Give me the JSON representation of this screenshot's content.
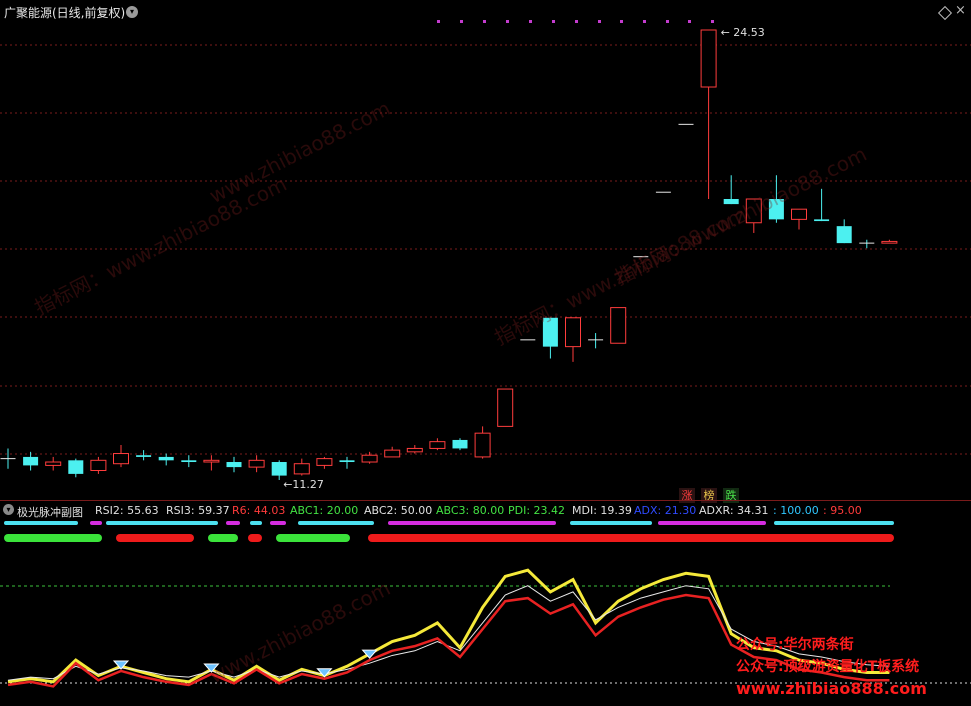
{
  "header": {
    "title": "广聚能源(日线,前复权)",
    "high_label": "24.53",
    "low_label": "11.27"
  },
  "tags": [
    "涨",
    "榜",
    "跌"
  ],
  "indicator": {
    "name": "极光脉冲副图",
    "fields": [
      {
        "text": "RSI2: 55.63",
        "color": "#e0e0e0"
      },
      {
        "text": "RSI3: 59.37",
        "color": "#e0e0e0"
      },
      {
        "text": "R6: 44.03",
        "color": "#ff3b3b"
      },
      {
        "text": "ABC1: 20.00",
        "color": "#43e243"
      },
      {
        "text": "ABC2: 50.00",
        "color": "#e0e0e0"
      },
      {
        "text": "ABC3: 80.00",
        "color": "#43e243"
      },
      {
        "text": "PDI: 23.42",
        "color": "#43e243"
      },
      {
        "text": "MDI: 19.39",
        "color": "#e0e0e0"
      },
      {
        "text": "ADX: 21.30",
        "color": "#2f4bff"
      },
      {
        "text": "ADXR: 34.31",
        "color": "#e0e0e0"
      },
      {
        "text": ": 100.00",
        "color": "#2fc7ff"
      },
      {
        "text": ": 95.00",
        "color": "#ff3b3b"
      }
    ]
  },
  "watermarks": [
    "指标网：www.zhibiao88.com",
    "指标网：www.zhibiao88.com",
    "www.zhibiao88.com",
    "指标网：www.zhibiao88.com",
    "www.zhibiao88.com"
  ],
  "promo": {
    "line1": "公众号:华尔两条街",
    "line2": "公众号:顶级游资量化T板系统",
    "line3": "www.zhibiao888.com"
  },
  "colors": {
    "up": "#ff3d3d",
    "down": "#4cf0f0",
    "grid": "#7a1b1b",
    "rsi": "#f5e93a"
  },
  "chart_data": {
    "type": "candlestick",
    "title": "广聚能源(日线,前复权)",
    "candles": [
      {
        "o": 11.9,
        "c": 11.9,
        "h": 12.2,
        "l": 11.6
      },
      {
        "o": 11.95,
        "c": 11.7,
        "h": 12.1,
        "l": 11.55
      },
      {
        "o": 11.7,
        "c": 11.8,
        "h": 11.95,
        "l": 11.55
      },
      {
        "o": 11.85,
        "c": 11.45,
        "h": 11.9,
        "l": 11.35
      },
      {
        "o": 11.55,
        "c": 11.85,
        "h": 11.95,
        "l": 11.45
      },
      {
        "o": 11.75,
        "c": 12.05,
        "h": 12.3,
        "l": 11.65
      },
      {
        "o": 12.0,
        "c": 11.95,
        "h": 12.15,
        "l": 11.85
      },
      {
        "o": 11.95,
        "c": 11.85,
        "h": 12.05,
        "l": 11.7
      },
      {
        "o": 11.85,
        "c": 11.8,
        "h": 12.0,
        "l": 11.65
      },
      {
        "o": 11.8,
        "c": 11.85,
        "h": 12.0,
        "l": 11.55
      },
      {
        "o": 11.8,
        "c": 11.65,
        "h": 11.95,
        "l": 11.5
      },
      {
        "o": 11.65,
        "c": 11.85,
        "h": 12.0,
        "l": 11.5
      },
      {
        "o": 11.8,
        "c": 11.4,
        "h": 11.85,
        "l": 11.27
      },
      {
        "o": 11.45,
        "c": 11.75,
        "h": 11.9,
        "l": 11.4
      },
      {
        "o": 11.7,
        "c": 11.9,
        "h": 11.95,
        "l": 11.6
      },
      {
        "o": 11.85,
        "c": 11.8,
        "h": 11.95,
        "l": 11.6
      },
      {
        "o": 11.8,
        "c": 12.0,
        "h": 12.1,
        "l": 11.75
      },
      {
        "o": 11.95,
        "c": 12.15,
        "h": 12.25,
        "l": 11.95
      },
      {
        "o": 12.1,
        "c": 12.2,
        "h": 12.3,
        "l": 12.05
      },
      {
        "o": 12.2,
        "c": 12.4,
        "h": 12.5,
        "l": 12.15
      },
      {
        "o": 12.45,
        "c": 12.2,
        "h": 12.5,
        "l": 12.15
      },
      {
        "o": 11.95,
        "c": 12.65,
        "h": 12.85,
        "l": 11.9
      },
      {
        "o": 12.85,
        "c": 13.95,
        "h": 13.95,
        "l": 12.85
      },
      {
        "o": 15.4,
        "c": 15.4,
        "h": 15.4,
        "l": 15.4
      },
      {
        "o": 16.05,
        "c": 15.2,
        "h": 16.05,
        "l": 14.85
      },
      {
        "o": 15.2,
        "c": 16.05,
        "h": 16.05,
        "l": 14.75
      },
      {
        "o": 15.4,
        "c": 15.4,
        "h": 15.6,
        "l": 15.15
      },
      {
        "o": 15.3,
        "c": 16.35,
        "h": 16.35,
        "l": 15.3
      },
      {
        "o": 17.85,
        "c": 17.85,
        "h": 17.85,
        "l": 17.85
      },
      {
        "o": 19.75,
        "c": 19.75,
        "h": 19.75,
        "l": 19.75
      },
      {
        "o": 21.75,
        "c": 21.75,
        "h": 21.75,
        "l": 21.75
      },
      {
        "o": 22.85,
        "c": 24.53,
        "h": 24.53,
        "l": 19.55
      },
      {
        "o": 19.55,
        "c": 19.4,
        "h": 20.25,
        "l": 19.4
      },
      {
        "o": 18.85,
        "c": 19.55,
        "h": 19.55,
        "l": 18.55
      },
      {
        "o": 19.55,
        "c": 18.95,
        "h": 20.25,
        "l": 18.85
      },
      {
        "o": 18.95,
        "c": 19.25,
        "h": 19.25,
        "l": 18.65
      },
      {
        "o": 18.95,
        "c": 18.9,
        "h": 19.85,
        "l": 18.9
      },
      {
        "o": 18.75,
        "c": 18.25,
        "h": 18.95,
        "l": 18.25
      },
      {
        "o": 18.25,
        "c": 18.25,
        "h": 18.35,
        "l": 18.1
      },
      {
        "o": 18.25,
        "c": 18.3,
        "h": 18.35,
        "l": 18.25
      }
    ],
    "marked_high": 24.53,
    "marked_low": 11.27,
    "sub_chart": {
      "series": [
        {
          "name": "RSI2",
          "values": [
            4,
            6,
            4,
            18,
            8,
            14,
            10,
            6,
            4,
            12,
            5,
            14,
            5,
            12,
            8,
            14,
            22,
            30,
            34,
            42,
            26,
            52,
            72,
            76,
            62,
            70,
            42,
            56,
            64,
            70,
            74,
            72,
            35,
            26,
            24,
            18,
            16,
            12,
            10,
            10
          ]
        },
        {
          "name": "RSI3",
          "values": [
            5,
            7,
            6,
            14,
            9,
            13,
            11,
            8,
            7,
            11,
            7,
            12,
            7,
            11,
            9,
            12,
            16,
            21,
            24,
            30,
            24,
            42,
            60,
            66,
            56,
            62,
            44,
            52,
            58,
            62,
            66,
            64,
            38,
            30,
            27,
            22,
            20,
            17,
            15,
            14
          ]
        },
        {
          "name": "R6",
          "values": [
            2,
            4,
            1,
            16,
            5,
            11,
            7,
            4,
            2,
            9,
            3,
            12,
            3,
            9,
            6,
            10,
            18,
            24,
            27,
            32,
            20,
            38,
            56,
            58,
            48,
            54,
            34,
            46,
            52,
            57,
            60,
            58,
            28,
            20,
            18,
            12,
            10,
            7,
            5,
            5
          ]
        }
      ]
    }
  }
}
